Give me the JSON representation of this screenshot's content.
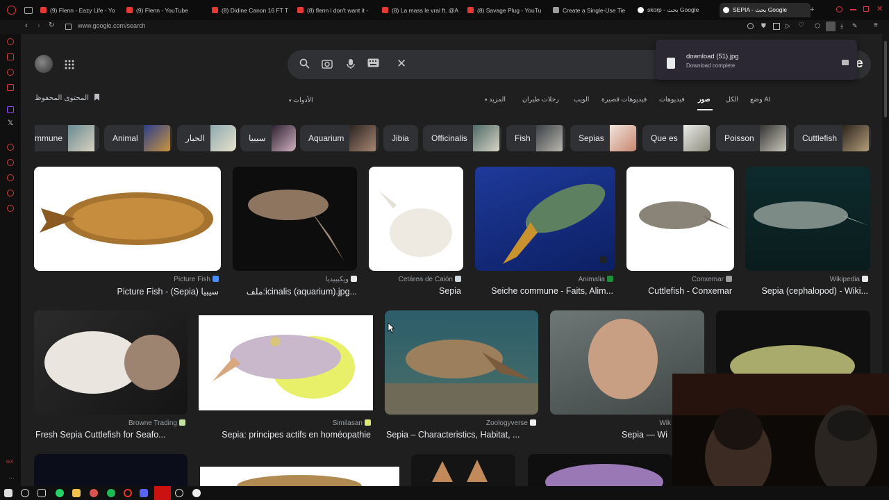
{
  "browser": {
    "tabs": [
      {
        "label": "(9) Flenn - Eazy Life - Yo",
        "fav": "#e53935"
      },
      {
        "label": "(9) Flenn - YouTube",
        "fav": "#e53935"
      },
      {
        "label": "(8) Didine Canon 16 FT T",
        "fav": "#e53935"
      },
      {
        "label": "(8) flenn i don't want it -",
        "fav": "#e53935"
      },
      {
        "label": "(8) La mass le vrai ft. @A",
        "fav": "#e53935"
      },
      {
        "label": "(8) Savage Plug - YouTu",
        "fav": "#e53935"
      },
      {
        "label": "Create a Single-Use Tie",
        "fav": "#9e9e9e"
      },
      {
        "label": "skorp - بحث Google",
        "fav": "#ffffff"
      },
      {
        "label": "SEPIA - بحث Google",
        "fav": "#ffffff"
      }
    ],
    "url": "www.google.com/search"
  },
  "download": {
    "filename": "download (51).jpg",
    "status": "Download complete"
  },
  "header": {
    "saved_label": "المحتوى المحفوظ",
    "tools_label": "الأدوات"
  },
  "nav_tabs": [
    {
      "label": "وضع AI"
    },
    {
      "label": "الكل"
    },
    {
      "label": "صور",
      "active": true
    },
    {
      "label": "فيديوهات"
    },
    {
      "label": "فيديوهات قصيرة"
    },
    {
      "label": "الويب"
    },
    {
      "label": "رحلات طيران"
    },
    {
      "label": "المزيد"
    }
  ],
  "chips": [
    {
      "label": "mmune",
      "thumb": "#6a8a92"
    },
    {
      "label": "Animal",
      "thumb": "#3f56a6"
    },
    {
      "label": "الحبار",
      "thumb": "#8fa9b0"
    },
    {
      "label": "سيبيا",
      "thumb": "#7c6677"
    },
    {
      "label": "Aquarium",
      "thumb": "#4a3f3b"
    },
    {
      "label": "Jibia",
      "thumb": null
    },
    {
      "label": "Officinalis",
      "thumb": "#7d8f86"
    },
    {
      "label": "Fish",
      "thumb": "#5a5f66"
    },
    {
      "label": "Sepias",
      "thumb": "#c99a88"
    },
    {
      "label": "Que es",
      "thumb": "#c5c5c5"
    },
    {
      "label": "Poisson",
      "thumb": "#777"
    },
    {
      "label": "Cuttlefish",
      "thumb": "#5e5446"
    }
  ],
  "results_row1": [
    {
      "source": "Picture Fish",
      "title": "Picture Fish - (Sepia) سيبيا",
      "badge": "#4a8df6"
    },
    {
      "source": "ويكيبيديا",
      "title": "ملف:icinalis (aquarium).jpg...",
      "badge": "#e8eaed"
    },
    {
      "source": "Cetárea de Caión",
      "title": "Sepia",
      "badge": "#cfd8dc"
    },
    {
      "source": "Animalia",
      "title": "Seiche commune - Faits, Alim...",
      "badge": "#1e8e3e"
    },
    {
      "source": "Conxemar",
      "title": "Cuttlefish - Conxemar",
      "badge": "#9e9e9e"
    },
    {
      "source": "Wikipedia",
      "title": "Sepia (cephalopod) - Wiki...",
      "badge": "#e8eaed"
    }
  ],
  "results_row2": [
    {
      "source": "Browne Trading",
      "title": "Fresh Sepia Cuttlefish for Seafo...",
      "badge": "#c5e1a5"
    },
    {
      "source": "Similasan",
      "title": "Sepia: principes actifs en homéopathie",
      "badge": "#dce775"
    },
    {
      "source": "Zoologyverse",
      "title": "Sepia – Characteristics, Habitat, ...",
      "badge": "#eeeeee"
    },
    {
      "source": "Wik",
      "title": "Sepia — Wi",
      "badge": "#e8eaed"
    }
  ]
}
